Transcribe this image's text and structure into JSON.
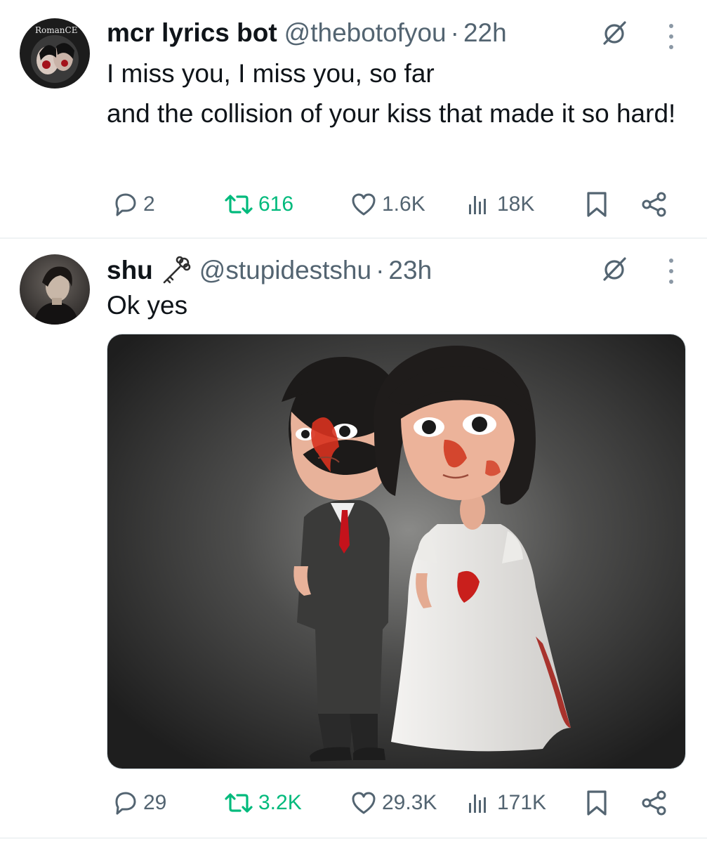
{
  "tweets": [
    {
      "author": {
        "name": "mcr lyrics bot",
        "handle": "@thebotofyou",
        "time": "22h",
        "avatar_text": "RomanCE"
      },
      "text_lines": [
        "I miss you, I miss you, so far",
        "and the collision of your kiss that made it so hard!"
      ],
      "stats": {
        "replies": "2",
        "retweets": "616",
        "likes": "1.6K",
        "views": "18K"
      }
    },
    {
      "author": {
        "name": "shu",
        "name_emoji": "key",
        "handle": "@stupidestshu",
        "time": "23h"
      },
      "text": "Ok yes",
      "media": {
        "kind": "image",
        "subject": "cartoon bride and groom figures with red paint splatter"
      },
      "stats": {
        "replies": "29",
        "retweets": "3.2K",
        "likes": "29.3K",
        "views": "171K"
      }
    }
  ],
  "icons": {
    "reply": "reply-icon",
    "retweet": "retweet-icon",
    "like": "heart-icon",
    "views": "views-icon",
    "bookmark": "bookmark-icon",
    "share": "share-icon",
    "grok": "grok-icon",
    "more": "more-icon"
  },
  "colors": {
    "text_primary": "#0f1419",
    "text_secondary": "#536471",
    "retweet_active": "#00ba7c",
    "divider": "#eff3f4"
  },
  "separator": "·"
}
